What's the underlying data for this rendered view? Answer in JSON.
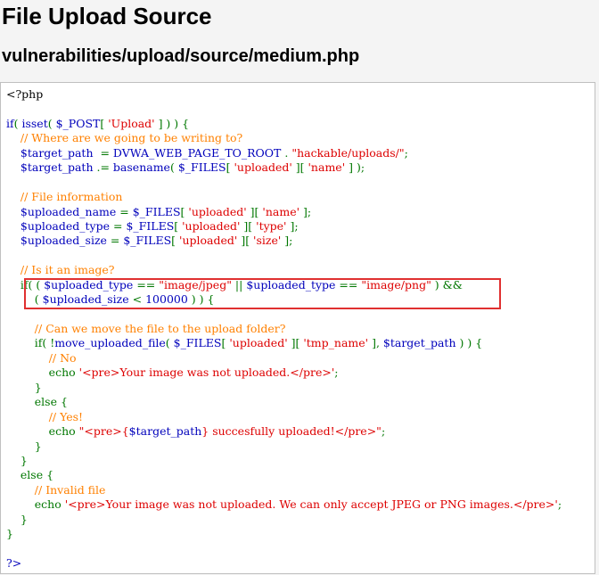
{
  "page": {
    "title": "File Upload Source",
    "subtitle": "vulnerabilities/upload/source/medium.php"
  },
  "colors": {
    "default": "#0000bb",
    "keyword": "#007700",
    "string": "#dd0000",
    "comment": "#ff8000",
    "highlight_border": "#e03030"
  },
  "code": {
    "lines": [
      [
        [
          "html",
          "<?php"
        ]
      ],
      [],
      [
        [
          "default",
          "if"
        ],
        [
          "keyword",
          "( "
        ],
        [
          "default",
          "isset"
        ],
        [
          "keyword",
          "( "
        ],
        [
          "default",
          "$_POST"
        ],
        [
          "keyword",
          "[ "
        ],
        [
          "string",
          "'Upload'"
        ],
        [
          "keyword",
          " ] ) ) {"
        ]
      ],
      [
        [
          "keyword",
          "    "
        ],
        [
          "comment",
          "// Where are we going to be writing to?"
        ]
      ],
      [
        [
          "keyword",
          "    "
        ],
        [
          "default",
          "$target_path"
        ],
        [
          "keyword",
          "  = "
        ],
        [
          "default",
          "DVWA_WEB_PAGE_TO_ROOT"
        ],
        [
          "keyword",
          " . "
        ],
        [
          "string",
          "\"hackable/uploads/\""
        ],
        [
          "keyword",
          ";"
        ]
      ],
      [
        [
          "keyword",
          "    "
        ],
        [
          "default",
          "$target_path"
        ],
        [
          "keyword",
          " .= "
        ],
        [
          "default",
          "basename"
        ],
        [
          "keyword",
          "( "
        ],
        [
          "default",
          "$_FILES"
        ],
        [
          "keyword",
          "[ "
        ],
        [
          "string",
          "'uploaded'"
        ],
        [
          "keyword",
          " ][ "
        ],
        [
          "string",
          "'name'"
        ],
        [
          "keyword",
          " ] );"
        ]
      ],
      [],
      [
        [
          "keyword",
          "    "
        ],
        [
          "comment",
          "// File information"
        ]
      ],
      [
        [
          "keyword",
          "    "
        ],
        [
          "default",
          "$uploaded_name"
        ],
        [
          "keyword",
          " = "
        ],
        [
          "default",
          "$_FILES"
        ],
        [
          "keyword",
          "[ "
        ],
        [
          "string",
          "'uploaded'"
        ],
        [
          "keyword",
          " ][ "
        ],
        [
          "string",
          "'name'"
        ],
        [
          "keyword",
          " ];"
        ]
      ],
      [
        [
          "keyword",
          "    "
        ],
        [
          "default",
          "$uploaded_type"
        ],
        [
          "keyword",
          " = "
        ],
        [
          "default",
          "$_FILES"
        ],
        [
          "keyword",
          "[ "
        ],
        [
          "string",
          "'uploaded'"
        ],
        [
          "keyword",
          " ][ "
        ],
        [
          "string",
          "'type'"
        ],
        [
          "keyword",
          " ];"
        ]
      ],
      [
        [
          "keyword",
          "    "
        ],
        [
          "default",
          "$uploaded_size"
        ],
        [
          "keyword",
          " = "
        ],
        [
          "default",
          "$_FILES"
        ],
        [
          "keyword",
          "[ "
        ],
        [
          "string",
          "'uploaded'"
        ],
        [
          "keyword",
          " ][ "
        ],
        [
          "string",
          "'size'"
        ],
        [
          "keyword",
          " ];"
        ]
      ],
      [],
      [
        [
          "keyword",
          "    "
        ],
        [
          "comment",
          "// Is it an image?"
        ]
      ],
      [
        [
          "keyword",
          "    if( ( "
        ],
        [
          "default",
          "$uploaded_type"
        ],
        [
          "keyword",
          " == "
        ],
        [
          "string",
          "\"image/jpeg\""
        ],
        [
          "keyword",
          " || "
        ],
        [
          "default",
          "$uploaded_type"
        ],
        [
          "keyword",
          " == "
        ],
        [
          "string",
          "\"image/png\""
        ],
        [
          "keyword",
          " ) &&"
        ]
      ],
      [
        [
          "keyword",
          "        ( "
        ],
        [
          "default",
          "$uploaded_size"
        ],
        [
          "keyword",
          " < "
        ],
        [
          "default",
          "100000"
        ],
        [
          "keyword",
          " ) ) {"
        ]
      ],
      [],
      [
        [
          "keyword",
          "        "
        ],
        [
          "comment",
          "// Can we move the file to the upload folder?"
        ]
      ],
      [
        [
          "keyword",
          "        if( !"
        ],
        [
          "default",
          "move_uploaded_file"
        ],
        [
          "keyword",
          "( "
        ],
        [
          "default",
          "$_FILES"
        ],
        [
          "keyword",
          "[ "
        ],
        [
          "string",
          "'uploaded'"
        ],
        [
          "keyword",
          " ][ "
        ],
        [
          "string",
          "'tmp_name'"
        ],
        [
          "keyword",
          " ], "
        ],
        [
          "default",
          "$target_path"
        ],
        [
          "keyword",
          " ) ) {"
        ]
      ],
      [
        [
          "keyword",
          "            "
        ],
        [
          "comment",
          "// No"
        ]
      ],
      [
        [
          "keyword",
          "            echo "
        ],
        [
          "string",
          "'<pre>Your image was not uploaded.</pre>'"
        ],
        [
          "keyword",
          ";"
        ]
      ],
      [
        [
          "keyword",
          "        }"
        ]
      ],
      [
        [
          "keyword",
          "        else {"
        ]
      ],
      [
        [
          "keyword",
          "            "
        ],
        [
          "comment",
          "// Yes!"
        ]
      ],
      [
        [
          "keyword",
          "            echo "
        ],
        [
          "string",
          "\"<pre>{"
        ],
        [
          "default",
          "$target_path"
        ],
        [
          "string",
          "} succesfully uploaded!</pre>\""
        ],
        [
          "keyword",
          ";"
        ]
      ],
      [
        [
          "keyword",
          "        }"
        ]
      ],
      [
        [
          "keyword",
          "    }"
        ]
      ],
      [
        [
          "keyword",
          "    else {"
        ]
      ],
      [
        [
          "keyword",
          "        "
        ],
        [
          "comment",
          "// Invalid file"
        ]
      ],
      [
        [
          "keyword",
          "        echo "
        ],
        [
          "string",
          "'<pre>Your image was not uploaded. We can only accept JPEG or PNG images.</pre>'"
        ],
        [
          "keyword",
          ";"
        ]
      ],
      [
        [
          "keyword",
          "    }"
        ]
      ],
      [
        [
          "keyword",
          "}"
        ]
      ],
      [],
      [
        [
          "default",
          "?>"
        ]
      ]
    ]
  }
}
